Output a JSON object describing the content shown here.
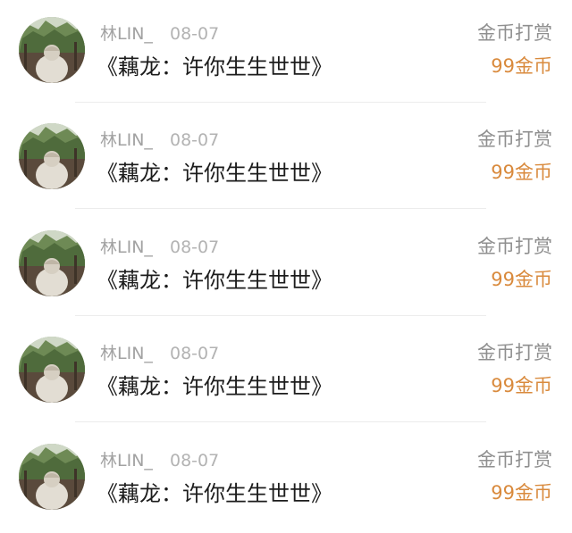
{
  "comments": [
    {
      "username": "林LIN_",
      "date": "08-07",
      "title": "《藕龙：许你生生世世》",
      "reward_type": "金币打赏",
      "reward_amount": "99金币",
      "avatar": "user-avatar-photo"
    },
    {
      "username": "林LIN_",
      "date": "08-07",
      "title": "《藕龙：许你生生世世》",
      "reward_type": "金币打赏",
      "reward_amount": "99金币",
      "avatar": "user-avatar-photo"
    },
    {
      "username": "林LIN_",
      "date": "08-07",
      "title": "《藕龙：许你生生世世》",
      "reward_type": "金币打赏",
      "reward_amount": "99金币",
      "avatar": "user-avatar-photo"
    },
    {
      "username": "林LIN_",
      "date": "08-07",
      "title": "《藕龙：许你生生世世》",
      "reward_type": "金币打赏",
      "reward_amount": "99金币",
      "avatar": "user-avatar-photo"
    },
    {
      "username": "林LIN_",
      "date": "08-07",
      "title": "《藕龙：许你生生世世》",
      "reward_type": "金币打赏",
      "reward_amount": "99金币",
      "avatar": "user-avatar-photo"
    }
  ],
  "colors": {
    "reward_amount": "#d98a3d",
    "username": "#a2a2a2",
    "title": "#1c1c1c"
  }
}
